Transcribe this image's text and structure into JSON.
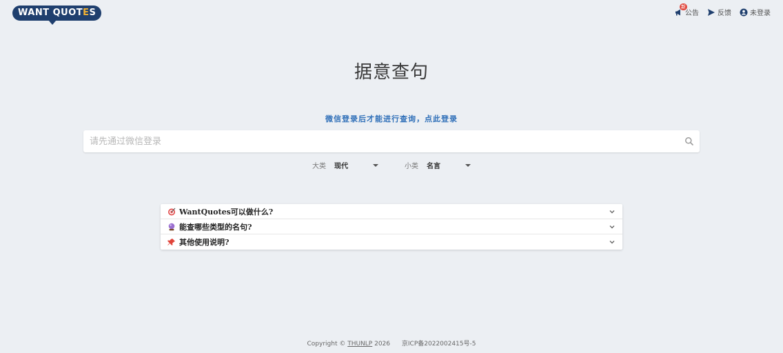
{
  "header": {
    "logo_pre": "WANT QUOT",
    "logo_accent": "E",
    "logo_post": "S",
    "nav": {
      "announce_label": "公告",
      "announce_badge": "新",
      "feedback_label": "反馈",
      "login_label": "未登录"
    }
  },
  "main": {
    "title": "据意查句",
    "login_hint": "微信登录后才能进行查询，点此登录",
    "search": {
      "placeholder": "请先通过微信登录",
      "value": ""
    },
    "filters": {
      "major_label": "大类",
      "major_value": "现代",
      "minor_label": "小类",
      "minor_value": "名言"
    }
  },
  "faq": [
    {
      "icon": "dart-icon",
      "label": "WantQuotes可以做什么?"
    },
    {
      "icon": "crystal-ball-icon",
      "label": "能查哪些类型的名句?"
    },
    {
      "icon": "pushpin-icon",
      "label": "其他使用说明?"
    }
  ],
  "footer": {
    "copyright_pre": "Copyright © ",
    "link": "THUNLP",
    "year": " 2026",
    "icp": "京ICP备2022002415号-5"
  },
  "colors": {
    "brand": "#1f3f6e",
    "accent": "#f2b233",
    "link": "#2f6fb8",
    "background": "#eceff3"
  }
}
